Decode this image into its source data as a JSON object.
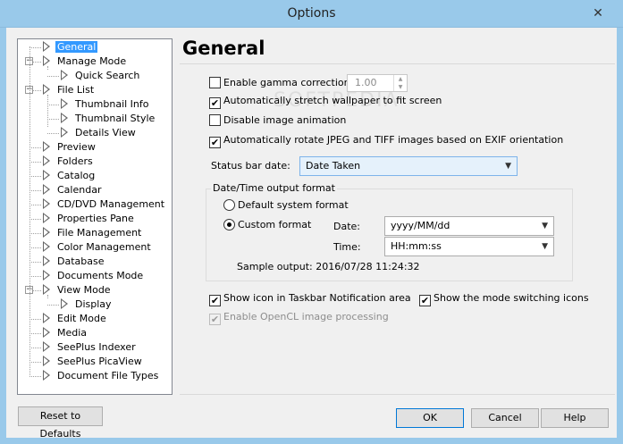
{
  "window": {
    "title": "Options",
    "close_glyph": "✕"
  },
  "watermark": "SOFTPEDIA",
  "tree": {
    "items": [
      {
        "label": "General",
        "level": 0,
        "selected": true
      },
      {
        "label": "Manage Mode",
        "level": 0,
        "expander": "−"
      },
      {
        "label": "Quick Search",
        "level": 1
      },
      {
        "label": "File List",
        "level": 0,
        "expander": "−"
      },
      {
        "label": "Thumbnail Info",
        "level": 1
      },
      {
        "label": "Thumbnail Style",
        "level": 1
      },
      {
        "label": "Details View",
        "level": 1
      },
      {
        "label": "Preview",
        "level": 0
      },
      {
        "label": "Folders",
        "level": 0
      },
      {
        "label": "Catalog",
        "level": 0
      },
      {
        "label": "Calendar",
        "level": 0
      },
      {
        "label": "CD/DVD Management",
        "level": 0
      },
      {
        "label": "Properties Pane",
        "level": 0
      },
      {
        "label": "File Management",
        "level": 0
      },
      {
        "label": "Color Management",
        "level": 0
      },
      {
        "label": "Database",
        "level": 0
      },
      {
        "label": "Documents Mode",
        "level": 0
      },
      {
        "label": "View Mode",
        "level": 0,
        "expander": "−"
      },
      {
        "label": "Display",
        "level": 1
      },
      {
        "label": "Edit Mode",
        "level": 0
      },
      {
        "label": "Media",
        "level": 0
      },
      {
        "label": "SeePlus Indexer",
        "level": 0
      },
      {
        "label": "SeePlus PicaView",
        "level": 0
      },
      {
        "label": "Document File Types",
        "level": 0
      }
    ]
  },
  "page": {
    "heading": "General"
  },
  "options": {
    "gamma": {
      "label": "Enable gamma correction:",
      "checked": false,
      "value": "1.00"
    },
    "stretch": {
      "label": "Automatically stretch wallpaper to fit screen",
      "checked": true
    },
    "animation": {
      "label": "Disable image animation",
      "checked": false
    },
    "rotate": {
      "label": "Automatically rotate JPEG and TIFF images based on EXIF orientation",
      "checked": true
    },
    "status_bar": {
      "label": "Status bar date:",
      "value": "Date Taken"
    },
    "datetime": {
      "title": "Date/Time output format",
      "default_label": "Default system format",
      "custom_label": "Custom format",
      "selected": "custom",
      "date_label": "Date:",
      "date_value": "yyyy/MM/dd",
      "time_label": "Time:",
      "time_value": "HH:mm:ss",
      "sample": "Sample output: 2016/07/28 11:24:32"
    },
    "taskbar": {
      "label": "Show icon in Taskbar Notification area",
      "checked": true
    },
    "mode_icons": {
      "label": "Show the mode switching icons",
      "checked": true
    },
    "opencl": {
      "label": "Enable OpenCL image processing",
      "checked": true,
      "disabled": true
    }
  },
  "buttons": {
    "reset": "Reset to Defaults",
    "ok": "OK",
    "cancel": "Cancel",
    "help": "Help"
  },
  "glyphs": {
    "check": "✔",
    "dropdown": "▼",
    "spin_up": "▲",
    "spin_down": "▼"
  }
}
